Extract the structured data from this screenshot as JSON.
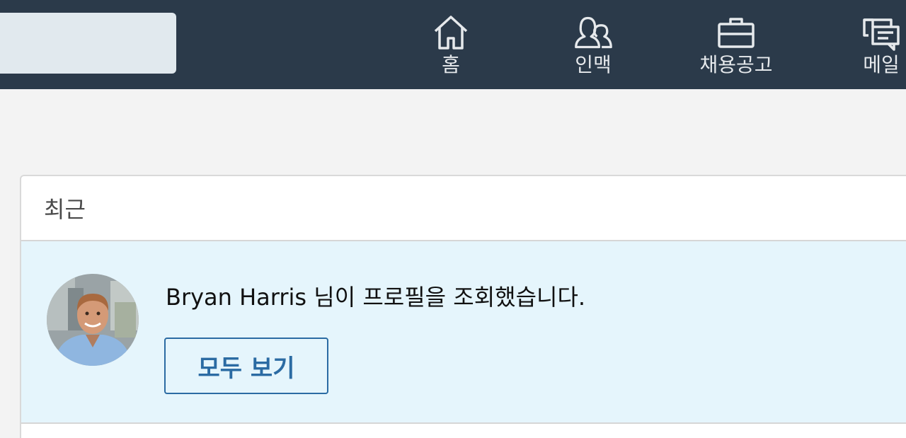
{
  "nav": {
    "home_label": "홈",
    "network_label": "인맥",
    "jobs_label": "채용공고",
    "messages_label": "메일"
  },
  "recent": {
    "title": "최근",
    "notification_text": "Bryan Harris 님이 프로필을 조회했습니다.",
    "view_all_label": "모두 보기"
  },
  "colors": {
    "topbar": "#2b3a4a",
    "accent": "#2b6ba3",
    "highlight_bg": "#e5f5fc"
  },
  "icons": {
    "home": "home-icon",
    "network": "people-icon",
    "jobs": "briefcase-icon",
    "messages": "chat-icon"
  }
}
